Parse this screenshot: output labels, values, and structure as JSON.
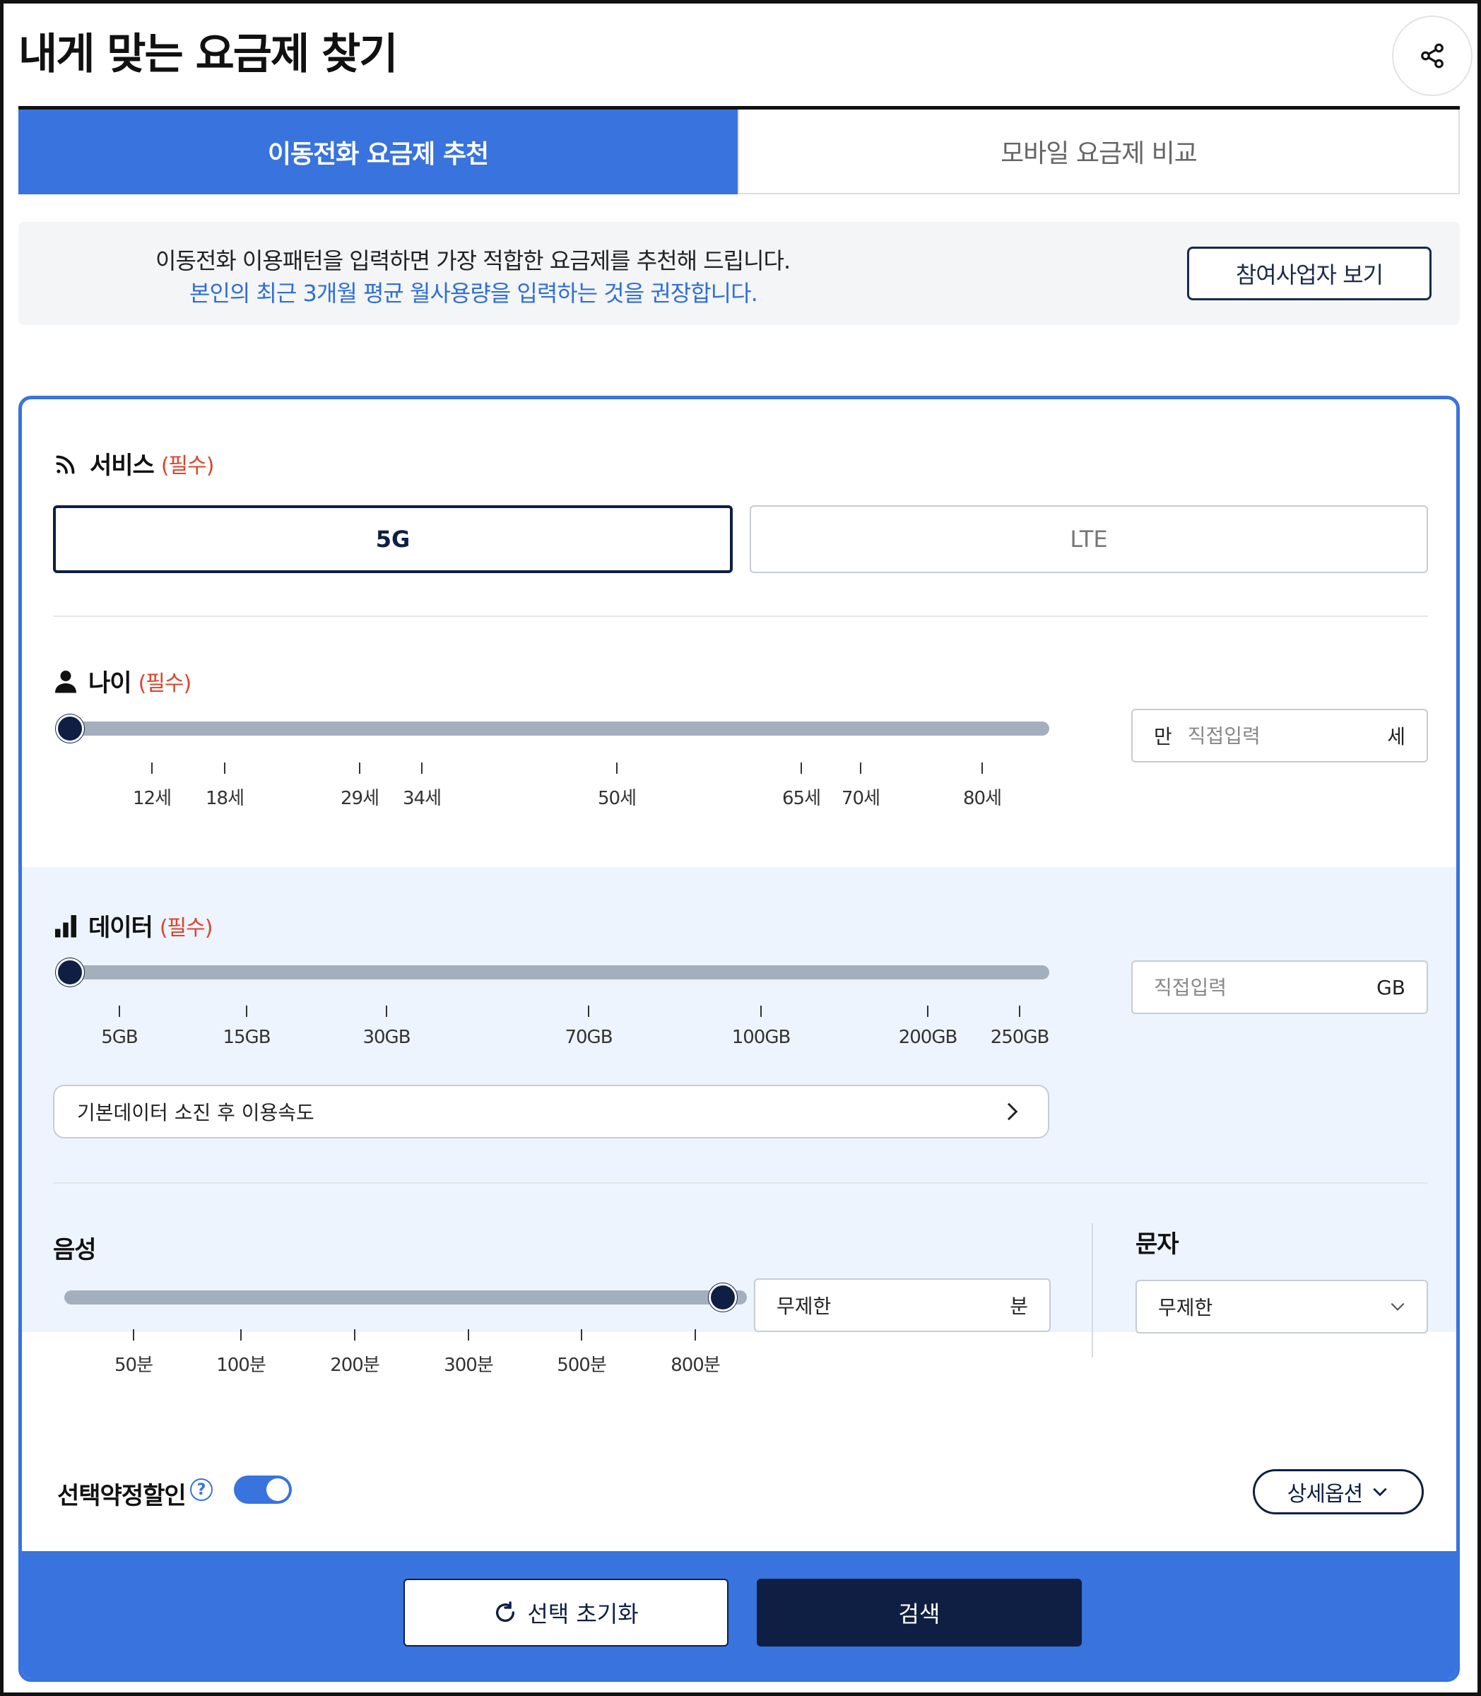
{
  "header": {
    "title": "내게 맞는 요금제 찾기"
  },
  "tabs": [
    {
      "label": "이동전화 요금제 추천"
    },
    {
      "label": "모바일 요금제 비교"
    }
  ],
  "notice": {
    "line1": "이동전화 이용패턴을 입력하면 가장 적합한 요금제를 추천해 드립니다.",
    "line2": "본인의 최근 3개월 평균 월사용량을 입력하는 것을 권장합니다.",
    "partner_button": "참여사업자 보기"
  },
  "service": {
    "label": "서비스",
    "required": "(필수)",
    "options": [
      "5G",
      "LTE"
    ],
    "selected": "5G"
  },
  "age": {
    "label": "나이",
    "required": "(필수)",
    "ticks": [
      "12세",
      "18세",
      "29세",
      "34세",
      "50세",
      "65세",
      "70세",
      "80세"
    ],
    "input_prefix": "만",
    "input_placeholder": "직접입력",
    "input_suffix": "세"
  },
  "data_usage": {
    "label": "데이터",
    "required": "(필수)",
    "ticks": [
      "5GB",
      "15GB",
      "30GB",
      "70GB",
      "100GB",
      "200GB",
      "250GB"
    ],
    "input_placeholder": "직접입력",
    "input_suffix": "GB",
    "speed_label": "기본데이터 소진 후 이용속도"
  },
  "voice": {
    "label": "음성",
    "ticks": [
      "50분",
      "100분",
      "200분",
      "300분",
      "500분",
      "800분"
    ],
    "input_value": "무제한",
    "input_suffix": "분"
  },
  "sms": {
    "label": "문자",
    "selected": "무제한"
  },
  "discount": {
    "label": "선택약정할인",
    "help": "?",
    "enabled": true,
    "detail_button": "상세옵션"
  },
  "actions": {
    "reset": "선택 초기화",
    "search": "검색"
  },
  "colors": {
    "primary_blue": "#3873de",
    "navy": "#0f1f44",
    "required_red": "#d9452d",
    "track_gray": "#a3afbd",
    "light_band": "#eef4fd"
  }
}
